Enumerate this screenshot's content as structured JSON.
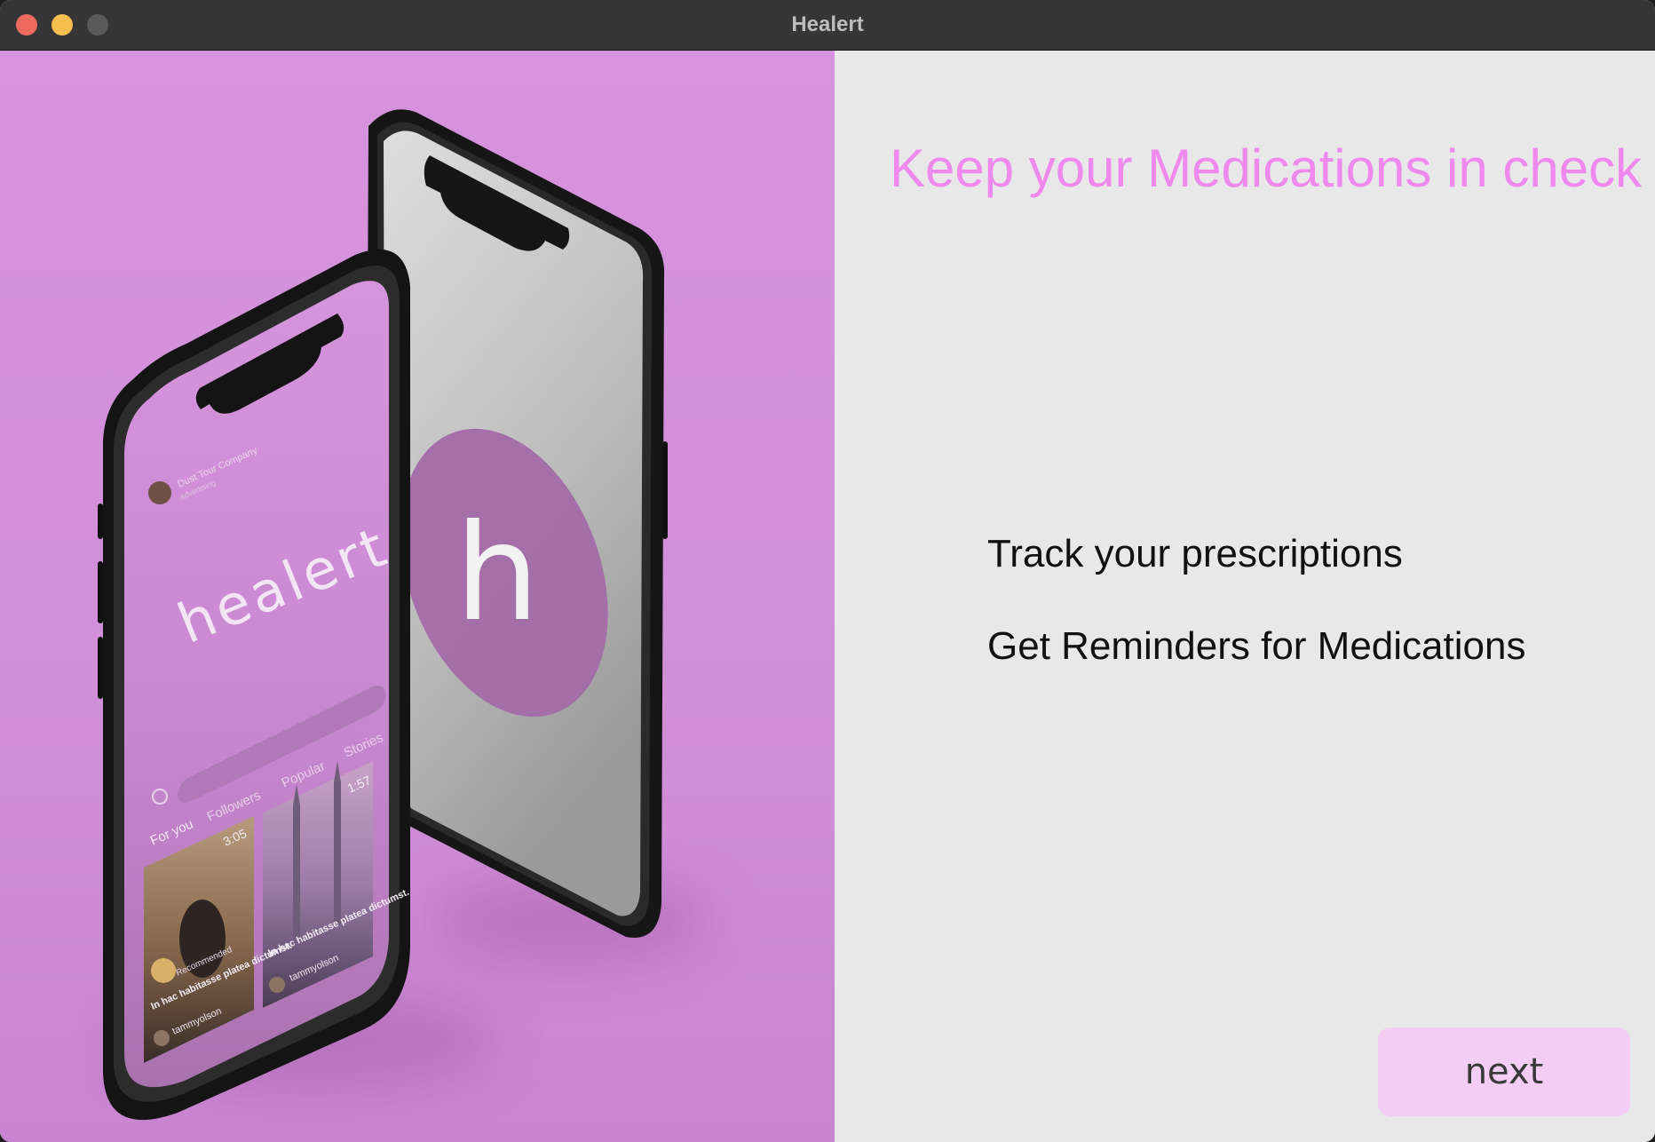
{
  "window": {
    "title": "Healert"
  },
  "hero": {
    "wordmark": "healert",
    "logo_letter": "h",
    "feed_tabs": [
      "For you",
      "Followers",
      "Popular",
      "Stories"
    ],
    "feed_company": "Dust Tour Company",
    "feed_company_sub": "advertising",
    "video_duration": "3:05",
    "video_duration_2": "1:57",
    "feed_caption": "In hac habitasse platea dictumst.",
    "feed_user": "tammyolson",
    "feed_recommended": "Recommended",
    "colors": {
      "panel": "#d793dd",
      "logo_disc": "#a36aa8"
    }
  },
  "content": {
    "headline": "Keep your Medications in check",
    "features": [
      "Track your prescriptions",
      "Get Reminders for Medications"
    ],
    "next_label": "next",
    "colors": {
      "headline": "#ef89ee",
      "button": "#f4cdf5"
    }
  }
}
